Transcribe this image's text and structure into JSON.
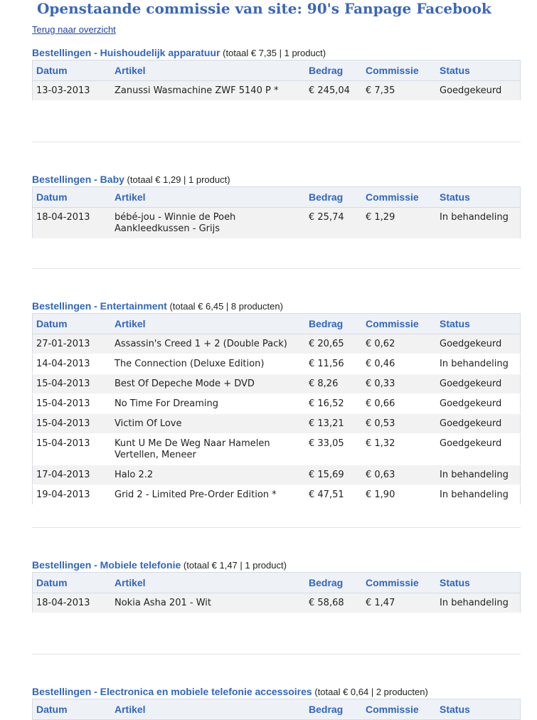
{
  "page": {
    "title": "Openstaande commissie van site: 90's Fanpage Facebook",
    "back_link": "Terug naar overzicht"
  },
  "columns": {
    "date": "Datum",
    "article": "Artikel",
    "amount": "Bedrag",
    "commission": "Commissie",
    "status": "Status"
  },
  "sections": [
    {
      "title": "Bestellingen - Huishoudelijk apparatuur",
      "summary": "(totaal € 7,35 | 1 product)",
      "rows": [
        {
          "date": "13-03-2013",
          "article": "Zanussi Wasmachine ZWF 5140 P *",
          "amount": "€ 245,04",
          "commission": "€ 7,35",
          "status": "Goedgekeurd"
        }
      ]
    },
    {
      "title": "Bestellingen - Baby",
      "summary": "(totaal € 1,29 | 1 product)",
      "rows": [
        {
          "date": "18-04-2013",
          "article": "bébé-jou - Winnie de Poeh Aankleedkussen - Grijs",
          "amount": "€ 25,74",
          "commission": "€ 1,29",
          "status": "In behandeling"
        }
      ]
    },
    {
      "title": "Bestellingen - Entertainment",
      "summary": "(totaal € 6,45 | 8 producten)",
      "rows": [
        {
          "date": "27-01-2013",
          "article": "Assassin's Creed 1 + 2 (Double Pack)",
          "amount": "€ 20,65",
          "commission": "€ 0,62",
          "status": "Goedgekeurd"
        },
        {
          "date": "14-04-2013",
          "article": "The Connection (Deluxe Edition)",
          "amount": "€ 11,56",
          "commission": "€ 0,46",
          "status": "In behandeling"
        },
        {
          "date": "15-04-2013",
          "article": "Best Of Depeche Mode + DVD",
          "amount": "€ 8,26",
          "commission": "€ 0,33",
          "status": "Goedgekeurd"
        },
        {
          "date": "15-04-2013",
          "article": "No Time For Dreaming",
          "amount": "€ 16,52",
          "commission": "€ 0,66",
          "status": "Goedgekeurd"
        },
        {
          "date": "15-04-2013",
          "article": "Victim Of Love",
          "amount": "€ 13,21",
          "commission": "€ 0,53",
          "status": "Goedgekeurd"
        },
        {
          "date": "15-04-2013",
          "article": "Kunt U Me De Weg Naar Hamelen Vertellen, Meneer",
          "amount": "€ 33,05",
          "commission": "€ 1,32",
          "status": "Goedgekeurd"
        },
        {
          "date": "17-04-2013",
          "article": "Halo 2.2",
          "amount": "€ 15,69",
          "commission": "€ 0,63",
          "status": "In behandeling"
        },
        {
          "date": "19-04-2013",
          "article": "Grid 2 - Limited Pre-Order Edition *",
          "amount": "€ 47,51",
          "commission": "€ 1,90",
          "status": "In behandeling"
        }
      ]
    },
    {
      "title": "Bestellingen - Mobiele telefonie",
      "summary": "(totaal € 1,47 | 1 product)",
      "rows": [
        {
          "date": "18-04-2013",
          "article": "Nokia Asha 201 - Wit",
          "amount": "€ 58,68",
          "commission": "€ 1,47",
          "status": "In behandeling"
        }
      ]
    },
    {
      "title": "Bestellingen - Electronica en mobiele telefonie accessoires",
      "summary": "(totaal € 0,64 | 2 producten)",
      "rows": []
    }
  ]
}
